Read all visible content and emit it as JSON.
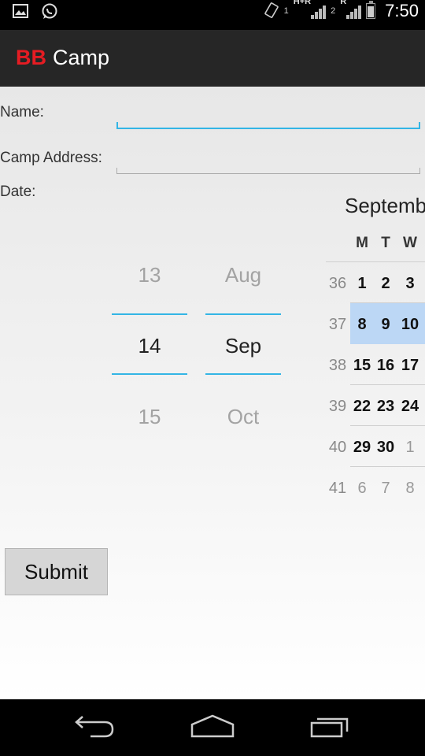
{
  "status_bar": {
    "time": "7:50",
    "sim1_network": "H+R",
    "sim1_slot": "1",
    "sim2_network": "R",
    "sim2_slot": "2",
    "icons": [
      "gallery-icon",
      "whatsapp-icon",
      "vibrate-icon",
      "signal-icon",
      "battery-icon"
    ]
  },
  "app_bar": {
    "title_brand": "BB",
    "title_rest": "Camp"
  },
  "form": {
    "name_label": "Name:",
    "name_value": "",
    "address_label": "Camp Address:",
    "address_value": "",
    "date_label": "Date:"
  },
  "date_picker": {
    "day": {
      "prev": "13",
      "current": "14",
      "next": "15"
    },
    "month": {
      "prev": "Aug",
      "current": "Sep",
      "next": "Oct"
    }
  },
  "calendar": {
    "month_title": "Septemb",
    "weekday_headers": [
      "M",
      "T",
      "W"
    ],
    "rows": [
      {
        "week": "36",
        "days": [
          "1",
          "2",
          "3"
        ]
      },
      {
        "week": "37",
        "days": [
          "8",
          "9",
          "10"
        ]
      },
      {
        "week": "38",
        "days": [
          "15",
          "16",
          "17"
        ]
      },
      {
        "week": "39",
        "days": [
          "22",
          "23",
          "24"
        ]
      },
      {
        "week": "40",
        "days": [
          "29",
          "30",
          "1"
        ]
      },
      {
        "week": "41",
        "days": [
          "6",
          "7",
          "8"
        ]
      }
    ],
    "selected_week": "37"
  },
  "actions": {
    "submit_label": "Submit"
  },
  "nav_bar": {
    "buttons": [
      "back-icon",
      "home-icon",
      "recent-apps-icon"
    ]
  },
  "colors": {
    "accent": "#33b5e5",
    "brand_red": "#e51c23",
    "selected_week_bg": "#bcd7f5"
  }
}
